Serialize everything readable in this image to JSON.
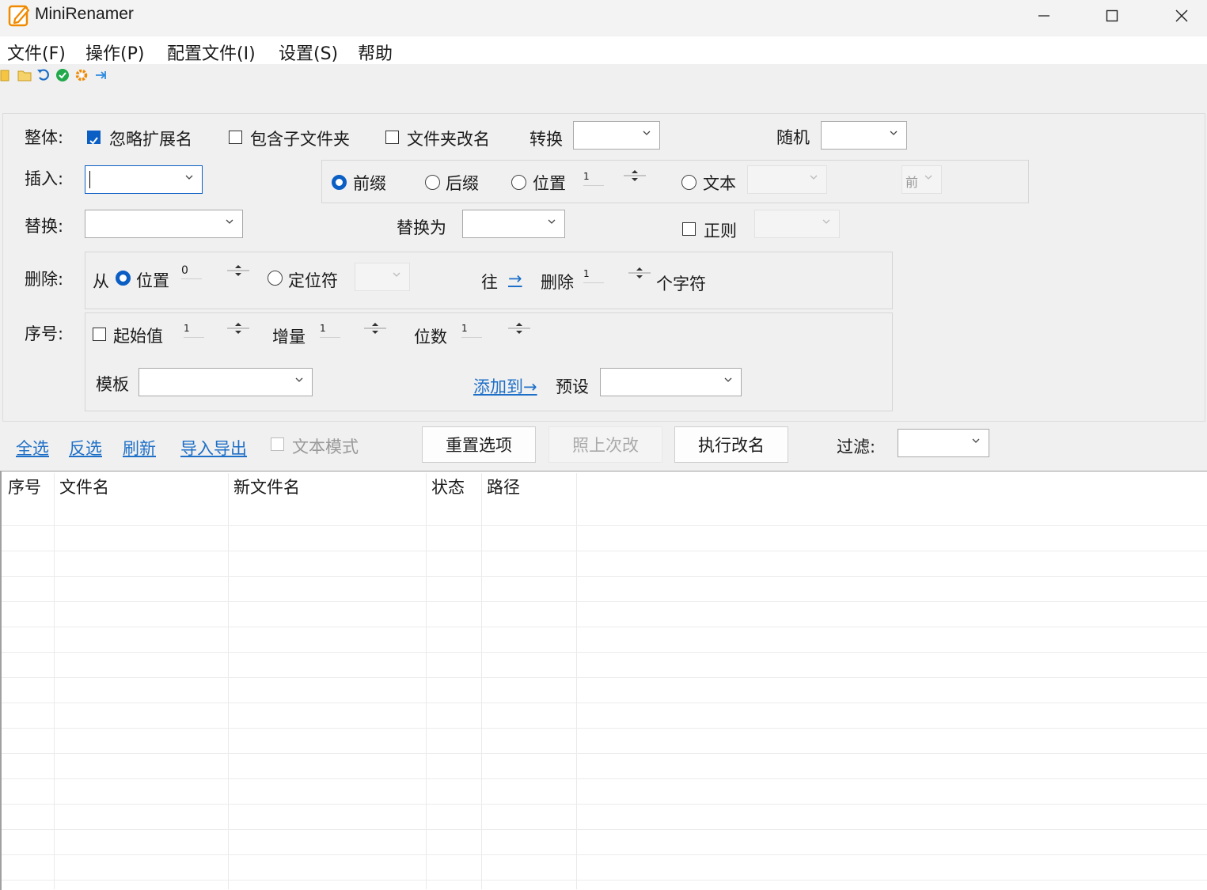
{
  "window": {
    "title": "MiniRenamer",
    "controls": [
      "minimize",
      "maximize",
      "close"
    ]
  },
  "menu": [
    "文件(F)",
    "操作(P)",
    "配置文件(I)",
    "设置(S)",
    "帮助"
  ],
  "toolbar": {
    "icons": [
      "folder-open-icon",
      "folder-icon",
      "undo-icon",
      "check-icon",
      "gear-icon",
      "pin-icon"
    ],
    "colors": {
      "folder": "#f5c542",
      "undo": "#1e6fc7",
      "check": "#22a94c",
      "gear": "#f08a00",
      "pin": "#2f8be0"
    }
  },
  "overall": {
    "label": "整体:",
    "ignore_ext": {
      "label": "忽略扩展名",
      "checked": true
    },
    "include_subfolders": {
      "label": "包含子文件夹",
      "checked": false
    },
    "rename_folders": {
      "label": "文件夹改名",
      "checked": false
    },
    "convert_label": "转换",
    "convert_value": "",
    "random_label": "随机",
    "random_value": ""
  },
  "insert": {
    "label": "插入:",
    "value": "",
    "prefix": "前缀",
    "suffix": "后缀",
    "position": "位置",
    "position_value": "1",
    "text": "文本",
    "text_value": "",
    "before_value": "前",
    "selected": "prefix"
  },
  "replace": {
    "label": "替换:",
    "value": "",
    "replace_with_label": "替换为",
    "replace_with_value": "",
    "regex": {
      "label": "正则",
      "checked": false
    },
    "regex_value": ""
  },
  "delete": {
    "label": "删除:",
    "from": "从",
    "position": "位置",
    "position_value": "0",
    "locator": "定位符",
    "locator_value": "",
    "direction_label": "往",
    "direction_arrow": "→",
    "delete_label": "删除",
    "count_value": "1",
    "unit": "个字符",
    "selected": "position"
  },
  "serial": {
    "label": "序号:",
    "start": {
      "label": "起始值",
      "checked": false,
      "value": "1"
    },
    "increment_label": "增量",
    "increment_value": "1",
    "digits_label": "位数",
    "digits_value": "1",
    "template_label": "模板",
    "template_value": "",
    "add_to_link": "添加到→",
    "preset_label": "预设",
    "preset_value": ""
  },
  "actions": {
    "select_all": "全选",
    "invert": "反选",
    "refresh": "刷新",
    "import_export": "导入导出",
    "text_mode": {
      "label": "文本模式",
      "checked": false
    },
    "reset_button": "重置选项",
    "same_as_last_button": "照上次改",
    "execute_button": "执行改名",
    "filter_label": "过滤:",
    "filter_value": ""
  },
  "table": {
    "columns": [
      "序号",
      "文件名",
      "新文件名",
      "状态",
      "路径"
    ],
    "rows": []
  }
}
